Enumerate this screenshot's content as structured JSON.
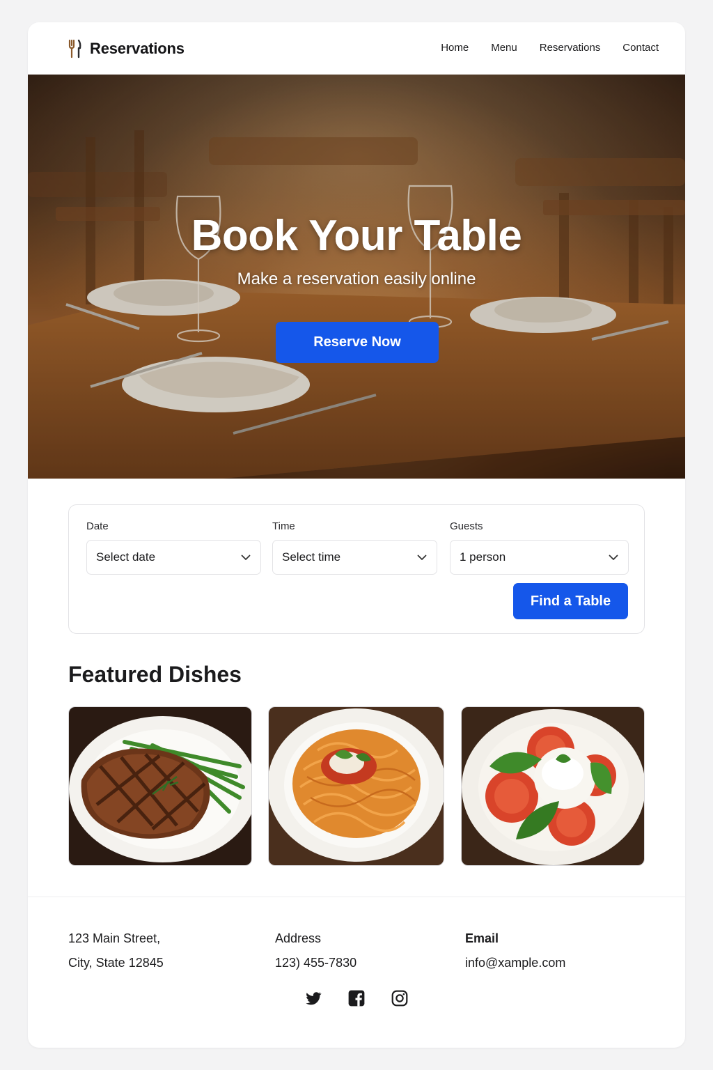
{
  "header": {
    "brand": "Reservations",
    "nav": [
      "Home",
      "Menu",
      "Reservations",
      "Contact"
    ]
  },
  "hero": {
    "title": "Book Your Table",
    "subtitle": "Make a reservation easily online",
    "cta_label": "Reserve Now"
  },
  "reservation_form": {
    "date": {
      "label": "Date",
      "value": "Select date"
    },
    "time": {
      "label": "Time",
      "value": "Select time"
    },
    "guests": {
      "label": "Guests",
      "value": "1 person"
    },
    "submit_label": "Find a Table"
  },
  "featured": {
    "title": "Featured Dishes",
    "dishes": [
      {
        "image": "grilled-steak-with-green-beans"
      },
      {
        "image": "spaghetti-with-tomato-sauce"
      },
      {
        "image": "caprese-burrata-salad"
      }
    ]
  },
  "footer": {
    "address_line1": "123 Main Street,",
    "address_line2": "City, State 12845",
    "address_heading": "Address",
    "phone": "123) 455-7830",
    "email_heading": "Email",
    "email": "info@xample.com",
    "socials": [
      "twitter-icon",
      "facebook-icon",
      "instagram-icon"
    ]
  },
  "colors": {
    "accent": "#1557ea",
    "text": "#1b1b1d",
    "background": "#f3f3f4",
    "card": "#ffffff",
    "border": "#e3e3e6"
  }
}
